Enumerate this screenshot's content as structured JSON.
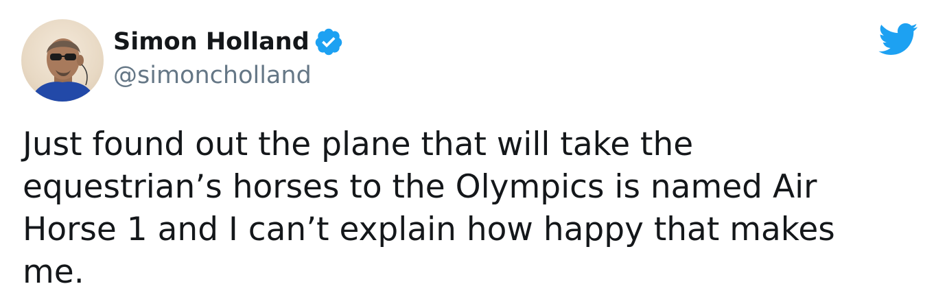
{
  "user": {
    "display_name": "Simon Holland",
    "handle": "@simoncholland",
    "verified": true
  },
  "tweet": {
    "text": "Just found out the plane that will take the\nequestrian’s horses to the Olympics is named Air\nHorse 1 and I can’t explain how happy that makes\nme."
  },
  "icons": {
    "verified": "verified-badge-icon",
    "brand": "twitter-bird-icon"
  },
  "colors": {
    "brand_blue": "#1da1f2",
    "name_text": "#14171a",
    "handle_text": "#657786"
  }
}
